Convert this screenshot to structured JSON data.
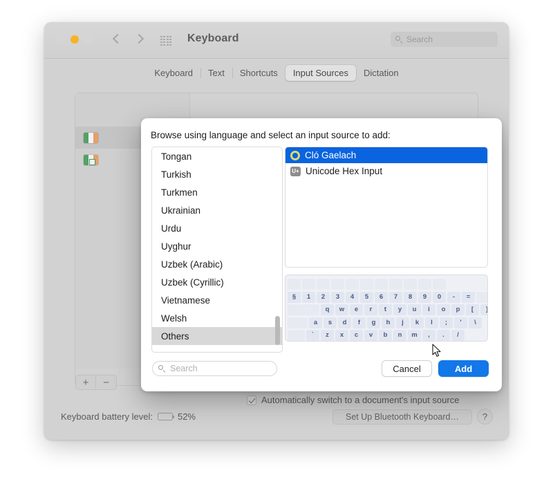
{
  "window": {
    "title": "Keyboard",
    "grid_icon": "app-grid-icon",
    "search_placeholder": "Search",
    "traffic_lights": [
      "close",
      "minimize",
      "maximize"
    ]
  },
  "tabs": [
    {
      "label": "Keyboard",
      "active": false
    },
    {
      "label": "Text",
      "active": false
    },
    {
      "label": "Shortcuts",
      "active": false
    },
    {
      "label": "Input Sources",
      "active": true
    },
    {
      "label": "Dictation",
      "active": false
    }
  ],
  "background_pane": {
    "input_sources": [
      {
        "name": "Irish flag source",
        "icon": "flag-ie-icon",
        "selected": true
      },
      {
        "name": "Irish flag source with badge",
        "icon": "flag-ie-badge-icon",
        "selected": false
      }
    ],
    "add_button_label": "+",
    "remove_button_label": "−",
    "auto_switch": {
      "label": "Automatically switch to a document's input source",
      "checked": true
    }
  },
  "footer": {
    "battery_label": "Keyboard battery level:",
    "battery_percent": "52%",
    "battery_fill": 52,
    "setup_bluetooth_label": "Set Up Bluetooth Keyboard…",
    "help_label": "?"
  },
  "dialog": {
    "prompt": "Browse using language and select an input source to add:",
    "languages": [
      "Tongan",
      "Turkish",
      "Turkmen",
      "Ukrainian",
      "Urdu",
      "Uyghur",
      "Uzbek (Arabic)",
      "Uzbek (Cyrillic)",
      "Vietnamese",
      "Welsh",
      "Others"
    ],
    "selected_language": "Others",
    "sources": [
      {
        "label": "Cló Gaelach",
        "icon": "ring-icon",
        "selected": true
      },
      {
        "label": "Unicode Hex Input",
        "icon": "u-plus-icon",
        "selected": false
      }
    ],
    "search_placeholder": "Search",
    "cancel_label": "Cancel",
    "add_label": "Add",
    "keyboard_preview": {
      "rows": [
        {
          "lead": 0,
          "keys": [
            "§",
            "1",
            "2",
            "3",
            "4",
            "5",
            "6",
            "7",
            "8",
            "9",
            "0",
            "-",
            "="
          ],
          "trail_wide": true
        },
        {
          "lead": 1,
          "keys": [
            "q",
            "w",
            "e",
            "r",
            "t",
            "y",
            "u",
            "i",
            "o",
            "p",
            "[",
            "]"
          ],
          "trail_wide": false
        },
        {
          "lead": 2,
          "keys": [
            "a",
            "s",
            "d",
            "f",
            "g",
            "h",
            "j",
            "k",
            "l",
            ";",
            "'",
            "\\"
          ],
          "trail_wide": false
        },
        {
          "lead": 1,
          "keys": [
            "`",
            "z",
            "x",
            "c",
            "v",
            "b",
            "n",
            "m",
            ",",
            ".",
            "/"
          ],
          "trail_wide": false
        }
      ]
    }
  },
  "colors": {
    "accent_blue": "#0a64e0",
    "button_blue": "#1277e8",
    "window_gray": "#d2d2d2",
    "selection_gray": "#d8d8d8",
    "keyboard_bg": "#eef0f6",
    "key_fill": "#e2e6f0",
    "key_text": "#4a5a83"
  }
}
